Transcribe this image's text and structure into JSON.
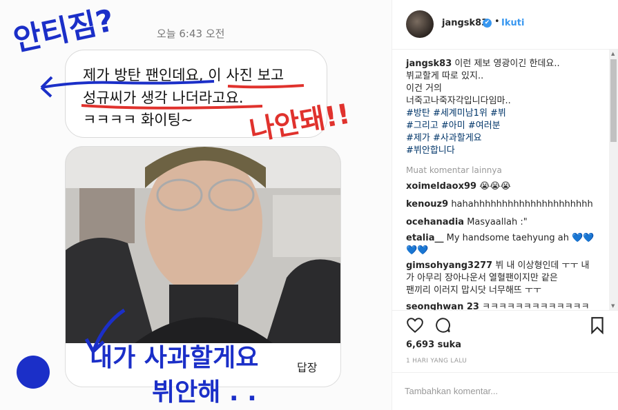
{
  "photo": {
    "timestamp": "오늘 6:43 오전",
    "message_lines": [
      "제가 방탄 팬인데요, 이 사진 보고",
      "성규씨가 생각 나더라고요.",
      "ㅋㅋㅋㅋ 화이팅~"
    ],
    "reply_label": "답장",
    "scrawl_top": "안티짐?",
    "scrawl_red": "나안돼!!",
    "scrawl_bottom_1": "내가 사과할게요",
    "scrawl_bottom_2": "뷔안해 . ."
  },
  "post": {
    "username": "jangsk83",
    "verified_glyph": "✔",
    "dot": "•",
    "follow_label": "Ikuti",
    "caption": {
      "username": "jangsk83",
      "lines": [
        "이런 제보 영광이긴 한데요..",
        "뷔교할게 따로 있지..",
        "이건 거의",
        "너죽고나죽자각입니다임마.."
      ],
      "hashtags": [
        "#방탄 #세계미남1위 #뷔",
        "#그리고 #아미 #여러분",
        "#제가 #사과할게요",
        "#뷔안합니다"
      ]
    },
    "load_more": "Muat komentar lainnya",
    "comments": [
      {
        "user": "xoimeldaox99",
        "text": "😭😭😭"
      },
      {
        "user": "kenouz9",
        "text": "hahahhhhhhhhhhhhhhhhhhhhh"
      },
      {
        "user": "ocehanadia",
        "text": "Masyaallah :\""
      },
      {
        "user": "etalia__",
        "text": "My handsome taehyung ah 💙💙",
        "text2": "💙💙"
      },
      {
        "user": "gimsohyang3277",
        "text": "뷔 내 이상형인데 ㅜㅜ 내",
        "text2": "가 아무리 장아나운서 열혈팬이지만 같은",
        "text3": "팬끼리 이러지 맙시닷 너무해뜨 ㅜㅜ"
      },
      {
        "user": "seonghwan 23",
        "text": "ㅋㅋㅋㅋㅋㅋㅋㅋㅋㅋㅋㅋㅋ"
      }
    ],
    "likes": "6,693 suka",
    "time_ago": "1 HARI YANG LALU",
    "add_comment_placeholder": "Tambahkan komentar..."
  }
}
